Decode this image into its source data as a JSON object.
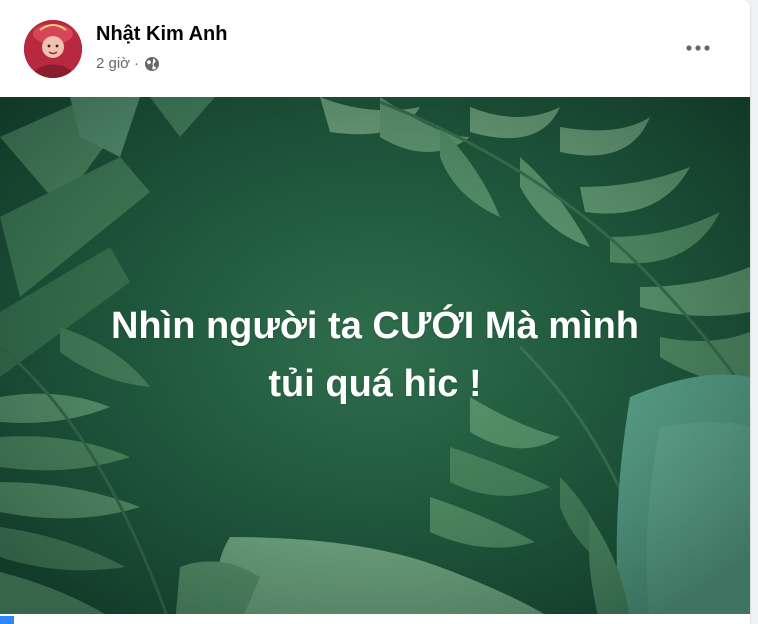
{
  "post": {
    "author_name": "Nhật Kim Anh",
    "timestamp": "2 giờ",
    "separator": "·",
    "audience_icon": "globe-icon",
    "more_icon": "more-options-icon"
  },
  "media": {
    "caption_line1": "Nhìn người ta CƯỚI Mà mình",
    "caption_line2": "tủi quá hic !",
    "background_colors": {
      "base": "#1f5a3d",
      "leaf_light": "#7fb08a",
      "leaf_mid": "#4f8f63",
      "leaf_teal": "#66b9a1"
    }
  },
  "colors": {
    "card_bg": "#ffffff",
    "page_bg": "#f0f2f5",
    "name_text": "#050505",
    "meta_text": "#65676b"
  }
}
